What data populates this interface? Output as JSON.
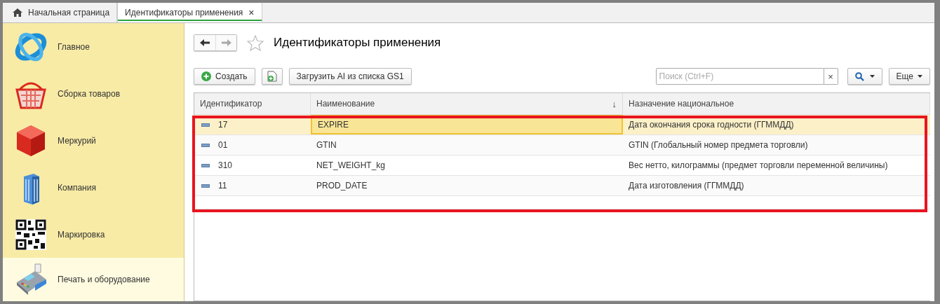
{
  "tabs": [
    {
      "label": "Начальная страница",
      "kind": "home",
      "selected": false
    },
    {
      "label": "Идентификаторы применения",
      "kind": "page",
      "selected": true,
      "close": "×"
    }
  ],
  "sidebar": {
    "items": [
      {
        "label": "Главное",
        "kind": "orbit",
        "selected": false
      },
      {
        "label": "Сборка товаров",
        "kind": "basket",
        "selected": false
      },
      {
        "label": "Меркурий",
        "kind": "cube",
        "selected": false
      },
      {
        "label": "Компания",
        "kind": "building",
        "selected": false
      },
      {
        "label": "Маркировка",
        "kind": "qr",
        "selected": false
      },
      {
        "label": "Печать и оборудование",
        "kind": "terminal",
        "selected": true
      }
    ]
  },
  "page": {
    "title": "Идентификаторы применения",
    "favorite": false
  },
  "toolbar": {
    "create": "Создать",
    "load": "Загрузить AI из списка GS1",
    "search": {
      "placeholder": "Поиск (Ctrl+F)",
      "clear": "×"
    },
    "more": "Еще"
  },
  "table": {
    "columns": [
      {
        "label": "Идентификатор"
      },
      {
        "label": "Наименование",
        "sort_mark": "↓"
      },
      {
        "label": "Назначение национальное"
      }
    ],
    "rows": [
      {
        "selected": true,
        "cells": [
          {
            "text": "17",
            "focused": false
          },
          {
            "text": "EXPIRE",
            "focused": true
          },
          {
            "text": "Дата окончания срока годности (ГГММДД)",
            "focused": false
          }
        ]
      },
      {
        "selected": false,
        "cells": [
          {
            "text": "01",
            "focused": false
          },
          {
            "text": "GTIN",
            "focused": false
          },
          {
            "text": "GTIN (Глобальный номер предмета торговли)",
            "focused": false
          }
        ]
      },
      {
        "selected": false,
        "cells": [
          {
            "text": "310",
            "focused": false
          },
          {
            "text": "NET_WEIGHT_kg",
            "focused": false
          },
          {
            "text": "Вес нетто, килограммы (предмет торговли переменной величины)",
            "focused": false
          }
        ]
      },
      {
        "selected": false,
        "cells": [
          {
            "text": "11",
            "focused": false
          },
          {
            "text": "PROD_DATE",
            "focused": false
          },
          {
            "text": "Дата изготовления (ГГММДД)",
            "focused": false
          }
        ]
      }
    ],
    "highlight_frame": {
      "color": "#e8151f"
    }
  }
}
